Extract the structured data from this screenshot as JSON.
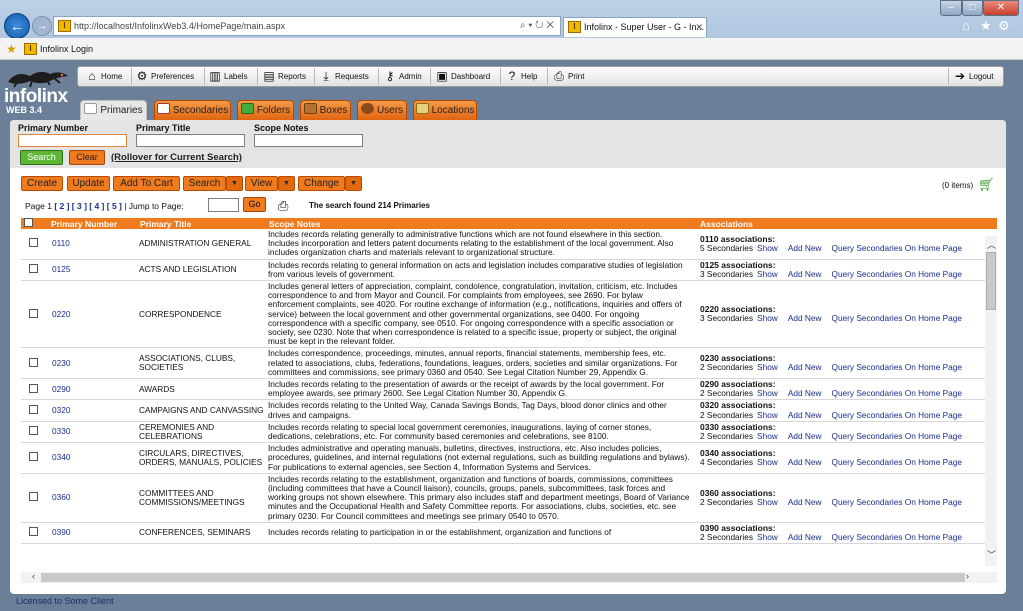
{
  "browser": {
    "url": "http://localhost/InfolinxWeb3.4/HomePage/main.aspx",
    "tab_title": "Infolinx - Super User - G - In...",
    "favorite": "Infolinx Login",
    "favicon_letter": "I"
  },
  "app": {
    "logo": "infolinx",
    "version": "WEB 3.4",
    "footer": "Licensed to Some Client"
  },
  "toolbar": {
    "home": "Home",
    "preferences": "Preferences",
    "labels": "Labels",
    "reports": "Reports",
    "requests": "Requests",
    "admin": "Admin",
    "dashboard": "Dashboard",
    "help": "Help",
    "print": "Print",
    "logout": "Logout"
  },
  "tabs": {
    "primaries": "Primaries",
    "secondaries": "Secondaries",
    "folders": "Folders",
    "boxes": "Boxes",
    "users": "Users",
    "locations": "Locations"
  },
  "search": {
    "primary_number_label": "Primary Number",
    "primary_title_label": "Primary Title",
    "scope_notes_label": "Scope Notes",
    "search_button": "Search",
    "clear_button": "Clear",
    "rollover_link": "(Rollover for Current Search)"
  },
  "actions": {
    "create": "Create",
    "update": "Update",
    "add_to_cart": "Add To Cart",
    "search": "Search",
    "view": "View",
    "change": "Change",
    "cart_items": "(0 items)"
  },
  "paging": {
    "page_label": "Page 1",
    "pages": "[ 2 ] [ 3 ] [ 4 ] [ 5 ]",
    "jump_label": "| Jump to Page:",
    "go_button": "Go",
    "result_text": "The search found 214 Primaries"
  },
  "grid": {
    "headers": {
      "number": "Primary Number",
      "title": "Primary Title",
      "notes": "Scope Notes",
      "assoc": "Associations"
    },
    "link_show": "Show",
    "link_add": "Add New",
    "link_query": "Query Secondaries On Home Page",
    "rows": [
      {
        "num": "0110",
        "title": "ADMINISTRATION GENERAL",
        "notes": "Includes records relating generally to administrative functions which are not found elsewhere in this section. Includes incorporation and letters patent documents relating to the establishment of the local government. Also includes organization charts and materials relevant to organizational structure.",
        "assoc": "0110 associations:",
        "count": "5 Secondaries"
      },
      {
        "num": "0125",
        "title": "ACTS AND LEGISLATION",
        "notes": "Includes records relating to general information on acts and legislation includes comparative studies of legislation from various levels of government.",
        "assoc": "0125 associations:",
        "count": "3 Secondaries"
      },
      {
        "num": "0220",
        "title": "CORRESPONDENCE",
        "notes": "Includes general letters of appreciation, complaint, condolence, congratulation, invitation, criticism, etc. Includes correspondence to and from Mayor and Council. For complaints from employees, see 2690. For bylaw enforcement complaints, see 4020. For routine exchange of information (e.g., notifications, inquiries and offers of service) between the local government and other governmental organizations, see 0400. For ongoing correspondence with a specific company, see 0510. For ongoing correspondence with a specific association or society, see 0230. Note that when correspondence is related to a specific issue, property or subject, the original must be kept in the relevant folder.",
        "assoc": "0220 associations:",
        "count": "3 Secondaries"
      },
      {
        "num": "0230",
        "title": "ASSOCIATIONS, CLUBS, SOCIETIES",
        "notes": "Includes correspondence, proceedings, minutes, annual reports, financial statements, membership fees, etc. related to associations, clubs, federations, foundations, leagues, orders, societies and similar organizations. For committees and commissions, see primary 0360 and 0540. See Legal Citation Number 29, Appendix G.",
        "assoc": "0230 associations:",
        "count": "2 Secondaries"
      },
      {
        "num": "0290",
        "title": "AWARDS",
        "notes": "Includes records relating to the presentation of awards or the receipt of awards by the local government. For employee awards, see primary 2600. See Legal Citation Number 30, Appendix G.",
        "assoc": "0290 associations:",
        "count": "2 Secondaries"
      },
      {
        "num": "0320",
        "title": "CAMPAIGNS AND CANVASSING",
        "notes": "Includes records relating to the United Way, Canada Savings Bonds, Tag Days, blood donor clinics and other drives and campaigns.",
        "assoc": "0320 associations:",
        "count": "2 Secondaries"
      },
      {
        "num": "0330",
        "title": "CEREMONIES AND CELEBRATIONS",
        "notes": "Includes records relating to special local government ceremonies, inaugurations, laying of corner stones, dedications, celebrations, etc. For community based ceremonies and celebrations, see 8100.",
        "assoc": "0330 associations:",
        "count": "2 Secondaries"
      },
      {
        "num": "0340",
        "title": "CIRCULARS, DIRECTIVES, ORDERS, MANUALS, POLICIES",
        "notes": "Includes administrative and operating manuals, bulletins, directives, instructions, etc. Also includes policies, procedures, guidelines, and internal regulations (not external regulations, such as building regulations and bylaws). For publications to external agencies, see Section 4, Information Systems and Services.",
        "assoc": "0340 associations:",
        "count": "4 Secondaries"
      },
      {
        "num": "0360",
        "title": "COMMITTEES AND COMMISSIONS/MEETINGS",
        "notes": "Includes records relating to the establishment, organization and functions of boards, commissions, committees (including committees that have a Council liaison), councils, groups, panels, subcommittees, task forces and working groups not shown elsewhere. This primary also includes staff and department meetings, Board of Variance minutes and the Occupational Health and Safety Committee reports. For associations, clubs, societies, etc. see primary 0230. For Council committees and meetings see primary 0540 to 0570.",
        "assoc": "0360 associations:",
        "count": "2 Secondaries"
      },
      {
        "num": "0390",
        "title": "CONFERENCES, SEMINARS",
        "notes": "Includes records relating to participation in or the establishment, organization and functions of",
        "assoc": "0390 associations:",
        "count": "2 Secondaries"
      }
    ]
  }
}
